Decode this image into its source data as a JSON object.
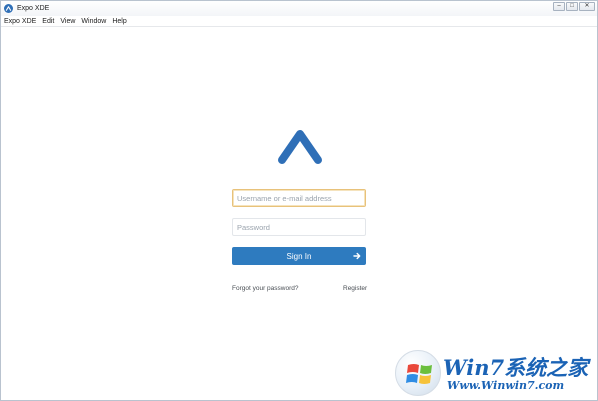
{
  "window": {
    "title": "Expo XDE",
    "controls": {
      "minimize": "–",
      "maximize": "□",
      "close": "✕"
    }
  },
  "menu": {
    "items": [
      "Expo XDE",
      "Edit",
      "View",
      "Window",
      "Help"
    ]
  },
  "login": {
    "username_placeholder": "Username or e-mail address",
    "password_placeholder": "Password",
    "signin_label": "Sign In",
    "forgot_label": "Forgot your password?",
    "register_label": "Register"
  },
  "watermark": {
    "title": "Win7系统之家",
    "url": "Www.Winwin7.com"
  },
  "colors": {
    "accent": "#2e7bbf",
    "logo": "#2f6fb7",
    "focus_border": "#e8c27a"
  },
  "icons": {
    "app": "expo-logo-icon",
    "signin": "arrow-right-icon",
    "watermark": "windows-flag-icon"
  }
}
